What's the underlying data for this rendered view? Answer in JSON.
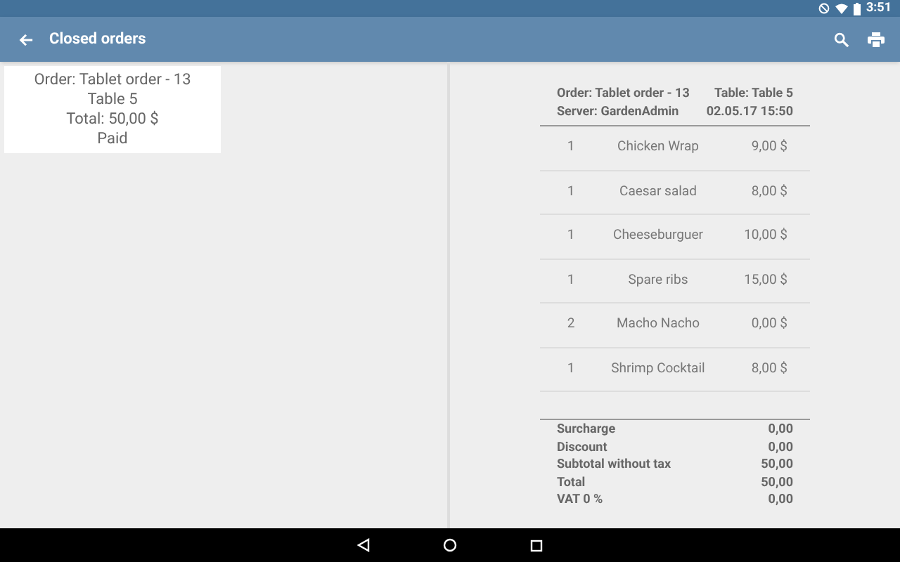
{
  "status_bar": {
    "time": "3:51"
  },
  "app_bar": {
    "title": "Closed orders"
  },
  "orders": [
    {
      "order": "Order: Tablet order - 13",
      "table": "Table 5",
      "total": "Total: 50,00 $",
      "status": "Paid"
    }
  ],
  "receipt": {
    "order": "Order: Tablet order - 13",
    "table": "Table: Table 5",
    "server": "Server: GardenAdmin",
    "date": "02.05.17 15:50",
    "items": [
      {
        "qty": "1",
        "name": "Chicken Wrap",
        "price": "9,00 $"
      },
      {
        "qty": "1",
        "name": "Caesar salad",
        "price": "8,00 $"
      },
      {
        "qty": "1",
        "name": "Cheeseburguer",
        "price": "10,00 $"
      },
      {
        "qty": "1",
        "name": "Spare ribs",
        "price": "15,00 $"
      },
      {
        "qty": "2",
        "name": "Macho Nacho",
        "price": "0,00 $"
      },
      {
        "qty": "1",
        "name": "Shrimp Cocktail",
        "price": "8,00 $"
      }
    ],
    "totals": [
      {
        "label": "Surcharge",
        "value": "0,00"
      },
      {
        "label": "Discount",
        "value": "0,00"
      },
      {
        "label": "Subtotal without tax",
        "value": "50,00"
      },
      {
        "label": "Total",
        "value": "50,00"
      },
      {
        "label": "VAT 0 %",
        "value": "0,00"
      }
    ]
  }
}
